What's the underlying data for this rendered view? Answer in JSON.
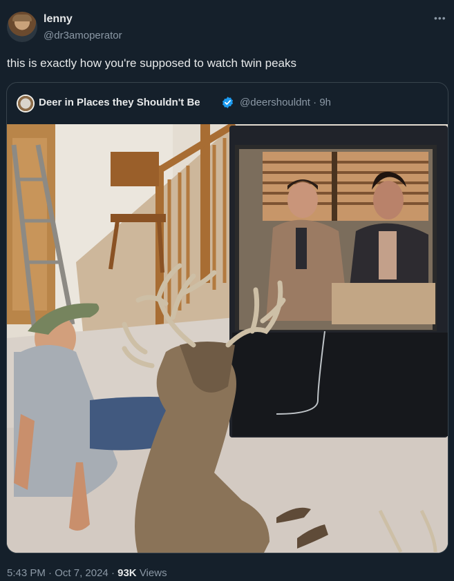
{
  "tweet": {
    "display_name": "lenny",
    "handle": "@dr3amoperator",
    "text": "this is exactly how you're supposed to watch twin peaks",
    "more_icon": "more-horizontal-icon"
  },
  "quote": {
    "display_name": "Deer in Places they Shouldn't Be",
    "verified_icon": "verified-badge-icon",
    "handle": "@deershouldnt",
    "separator": "·",
    "age": "9h"
  },
  "footer": {
    "time": "5:43 PM",
    "sep1": "·",
    "date": "Oct 7, 2024",
    "sep2": "·",
    "views_count": "93K",
    "views_label": "Views"
  },
  "colors": {
    "background": "#15202b",
    "text_primary": "#e7e9ea",
    "text_secondary": "#8b98a5",
    "border": "#38444d",
    "verified": "#1d9bf0"
  }
}
